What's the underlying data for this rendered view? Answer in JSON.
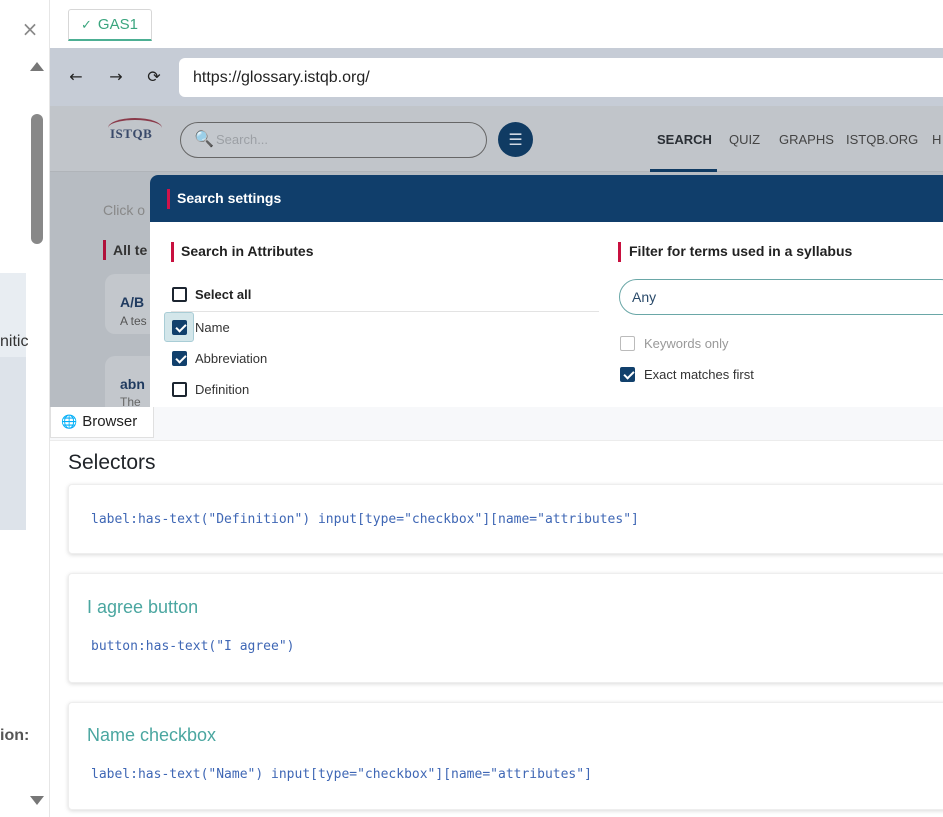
{
  "window": {
    "close_glyph": "×",
    "left_fragment_1": "nitic",
    "left_fragment_2": "ion:"
  },
  "tab": {
    "check_glyph": "✓",
    "label": "GAS1"
  },
  "browser": {
    "back_glyph": "←",
    "forward_glyph": "→",
    "reload_glyph": "⟳",
    "url": "https://glossary.istqb.org/",
    "label_glyph": "🌐",
    "label": "Browser"
  },
  "site": {
    "logo": "ISTQB",
    "search_icon_glyph": "🔍",
    "search_placeholder": "Search...",
    "filter_icon_glyph": "☰",
    "nav": [
      "SEARCH",
      "QUIZ",
      "GRAPHS",
      "ISTQB.ORG",
      "H"
    ],
    "click_hint": "Click o",
    "all_terms": "All te",
    "cards": [
      {
        "title": "A/B",
        "sub": "A tes"
      },
      {
        "title": "abn",
        "sub": "The"
      }
    ]
  },
  "modal": {
    "title": "Search settings",
    "section_attributes": "Search in Attributes",
    "section_syllabus": "Filter for terms used in a syllabus",
    "attributes": [
      {
        "label": "Select all",
        "checked": false
      },
      {
        "label": "Name",
        "checked": true
      },
      {
        "label": "Abbreviation",
        "checked": true
      },
      {
        "label": "Definition",
        "checked": false
      }
    ],
    "syllabus_value": "Any",
    "keywords_only": "Keywords only",
    "exact_matches": "Exact matches first"
  },
  "selectors": {
    "heading": "Selectors",
    "items": [
      {
        "title": "",
        "code": "label:has-text(\"Definition\") input[type=\"checkbox\"][name=\"attributes\"]"
      },
      {
        "title": "I agree button",
        "code": "button:has-text(\"I agree\")"
      },
      {
        "title": "Name checkbox",
        "code": "label:has-text(\"Name\") input[type=\"checkbox\"][name=\"attributes\"]"
      }
    ]
  },
  "colors": {
    "accent_teal": "#4aa6a0",
    "modal_header": "#103e6b",
    "accent_red": "#c8103f",
    "code_blue": "#3f67b5"
  }
}
